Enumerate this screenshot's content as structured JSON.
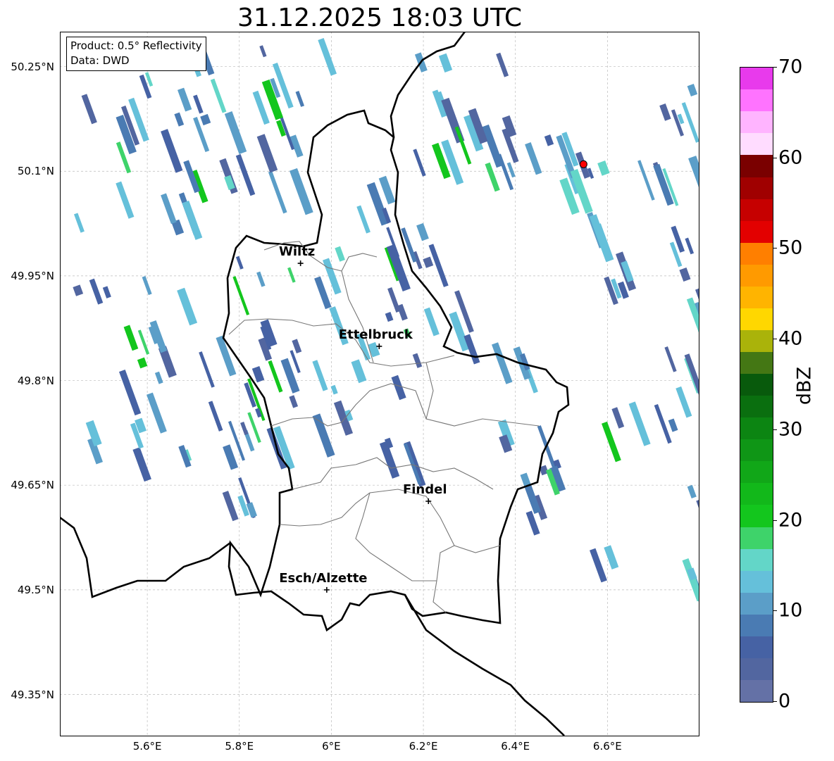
{
  "title": "31.12.2025 18:03 UTC",
  "info_box": {
    "line1": "Product: 0.5° Reflectivity",
    "line2": "Data: DWD"
  },
  "map_extent": {
    "lon": [
      5.41,
      6.8
    ],
    "lat": [
      49.29,
      50.3
    ]
  },
  "y_ticks": [
    {
      "value": 50.25,
      "label": "50.25°N"
    },
    {
      "value": 50.1,
      "label": "50.1°N"
    },
    {
      "value": 49.95,
      "label": "49.95°N"
    },
    {
      "value": 49.8,
      "label": "49.8°N"
    },
    {
      "value": 49.65,
      "label": "49.65°N"
    },
    {
      "value": 49.5,
      "label": "49.5°N"
    },
    {
      "value": 49.35,
      "label": "49.35°N"
    }
  ],
  "x_ticks": [
    {
      "value": 5.6,
      "label": "5.6°E"
    },
    {
      "value": 5.8,
      "label": "5.8°E"
    },
    {
      "value": 6.0,
      "label": "6°E"
    },
    {
      "value": 6.2,
      "label": "6.2°E"
    },
    {
      "value": 6.4,
      "label": "6.4°E"
    },
    {
      "value": 6.6,
      "label": "6.6°E"
    }
  ],
  "cities": [
    {
      "name": "Wiltz",
      "lon": 5.933,
      "lat": 49.968
    },
    {
      "name": "Ettelbruck",
      "lon": 6.104,
      "lat": 49.849
    },
    {
      "name": "Findel",
      "lon": 6.211,
      "lat": 49.627
    },
    {
      "name": "Esch/Alzette",
      "lon": 5.99,
      "lat": 49.5
    }
  ],
  "radar_site": {
    "lon": 6.548,
    "lat": 50.11,
    "color": "#ff0000"
  },
  "colorbar": {
    "label": "dBZ",
    "min": 0,
    "max": 70,
    "step": 2.5,
    "tick_labels": [
      "0",
      "10",
      "20",
      "30",
      "40",
      "50",
      "60",
      "70"
    ],
    "colors": [
      "#6471a6",
      "#5266a0",
      "#4662a4",
      "#4a7bb3",
      "#5b9ec8",
      "#65c0da",
      "#63d6c8",
      "#3ed36a",
      "#13c61d",
      "#12b81a",
      "#11a718",
      "#0f9616",
      "#0c8512",
      "#0a6f0f",
      "#085a0c",
      "#447714",
      "#aab30a",
      "#ffd700",
      "#ffb400",
      "#ff9a00",
      "#ff7f00",
      "#e30000",
      "#c60000",
      "#a00000",
      "#7a0000",
      "#ffdcff",
      "#ffb4ff",
      "#ff73ff",
      "#e83aec"
    ]
  }
}
